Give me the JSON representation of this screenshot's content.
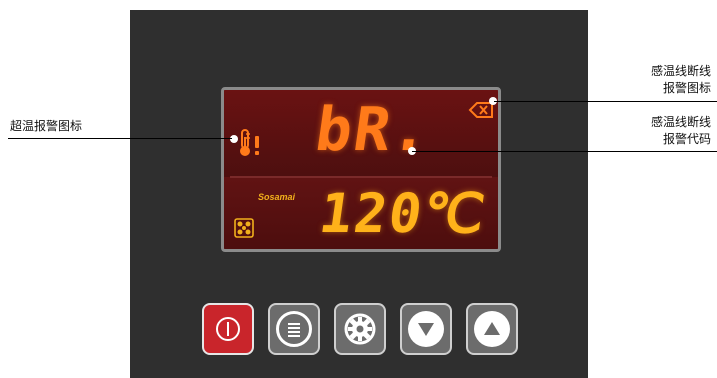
{
  "display": {
    "code": "bR.",
    "temperature": "120℃",
    "brand": "Sosamai"
  },
  "annotations": {
    "overtemp_icon": "超温报警图标",
    "sensor_break_icon_line1": "感温线断线",
    "sensor_break_icon_line2": "报警图标",
    "sensor_break_code_line1": "感温线断线",
    "sensor_break_code_line2": "报警代码"
  },
  "colors": {
    "panel": "#2f2f2f",
    "display_bg": "#5a1111",
    "segment_code": "#ff7a1a",
    "segment_temp": "#ffb21a",
    "power_button": "#c9252b",
    "grey_button": "#6c6c6c"
  },
  "buttons": [
    {
      "name": "power-button",
      "icon": "power-icon"
    },
    {
      "name": "menu-button",
      "icon": "menu-icon"
    },
    {
      "name": "settings-button",
      "icon": "gear-icon"
    },
    {
      "name": "down-button",
      "icon": "down-arrow-icon"
    },
    {
      "name": "up-button",
      "icon": "up-arrow-icon"
    }
  ]
}
